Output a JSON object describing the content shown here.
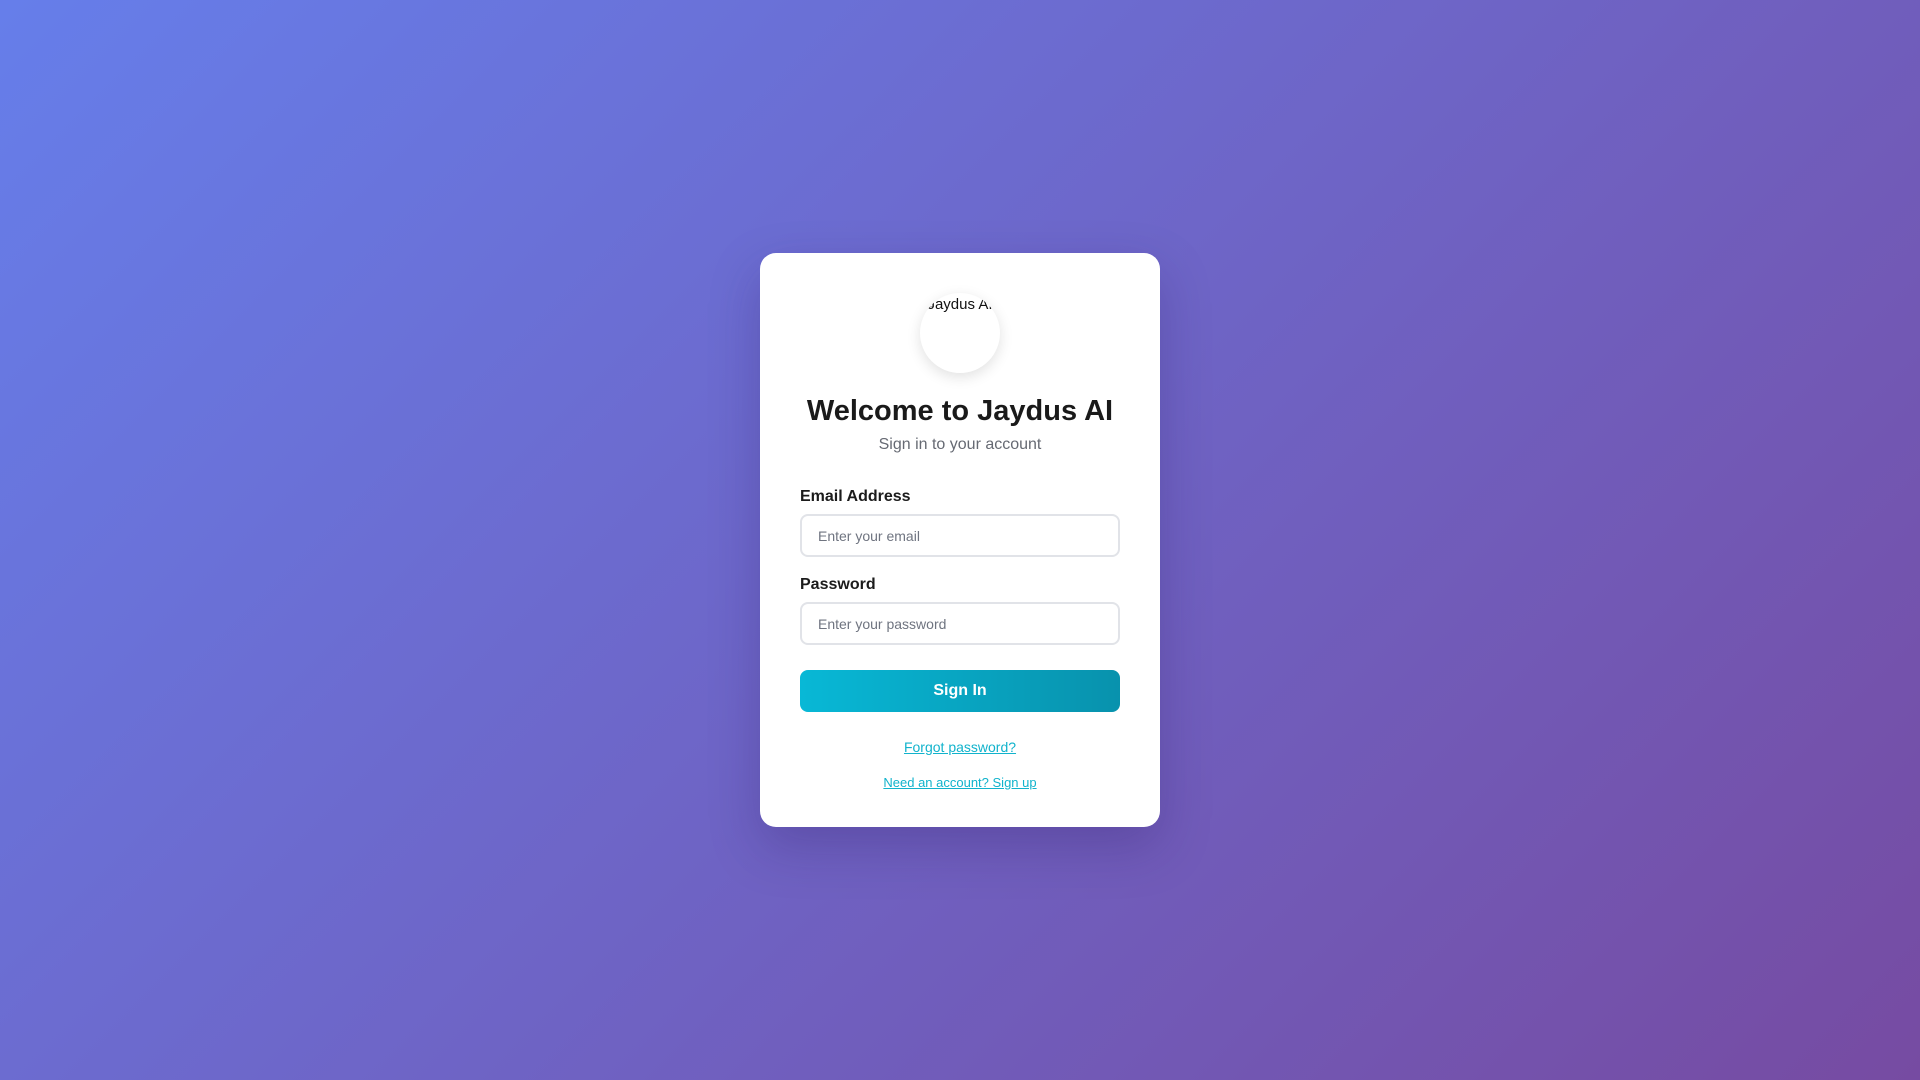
{
  "app": {
    "logo_alt": "Jaydus AI"
  },
  "login": {
    "title": "Welcome to Jaydus AI",
    "subtitle": "Sign in to your account",
    "email_label": "Email Address",
    "email_placeholder": "Enter your email",
    "email_value": "",
    "password_label": "Password",
    "password_placeholder": "Enter your password",
    "password_value": "",
    "signin_label": "Sign In",
    "forgot_label": "Forgot password?",
    "signup_label": "Need an account? Sign up"
  },
  "colors": {
    "background_start": "#667eea",
    "background_end": "#764ba2",
    "accent": "#08b8d6",
    "accent_dark": "#0892ad",
    "link": "#11b3cc"
  },
  "icons": {
    "logo": "broken-image-icon"
  }
}
